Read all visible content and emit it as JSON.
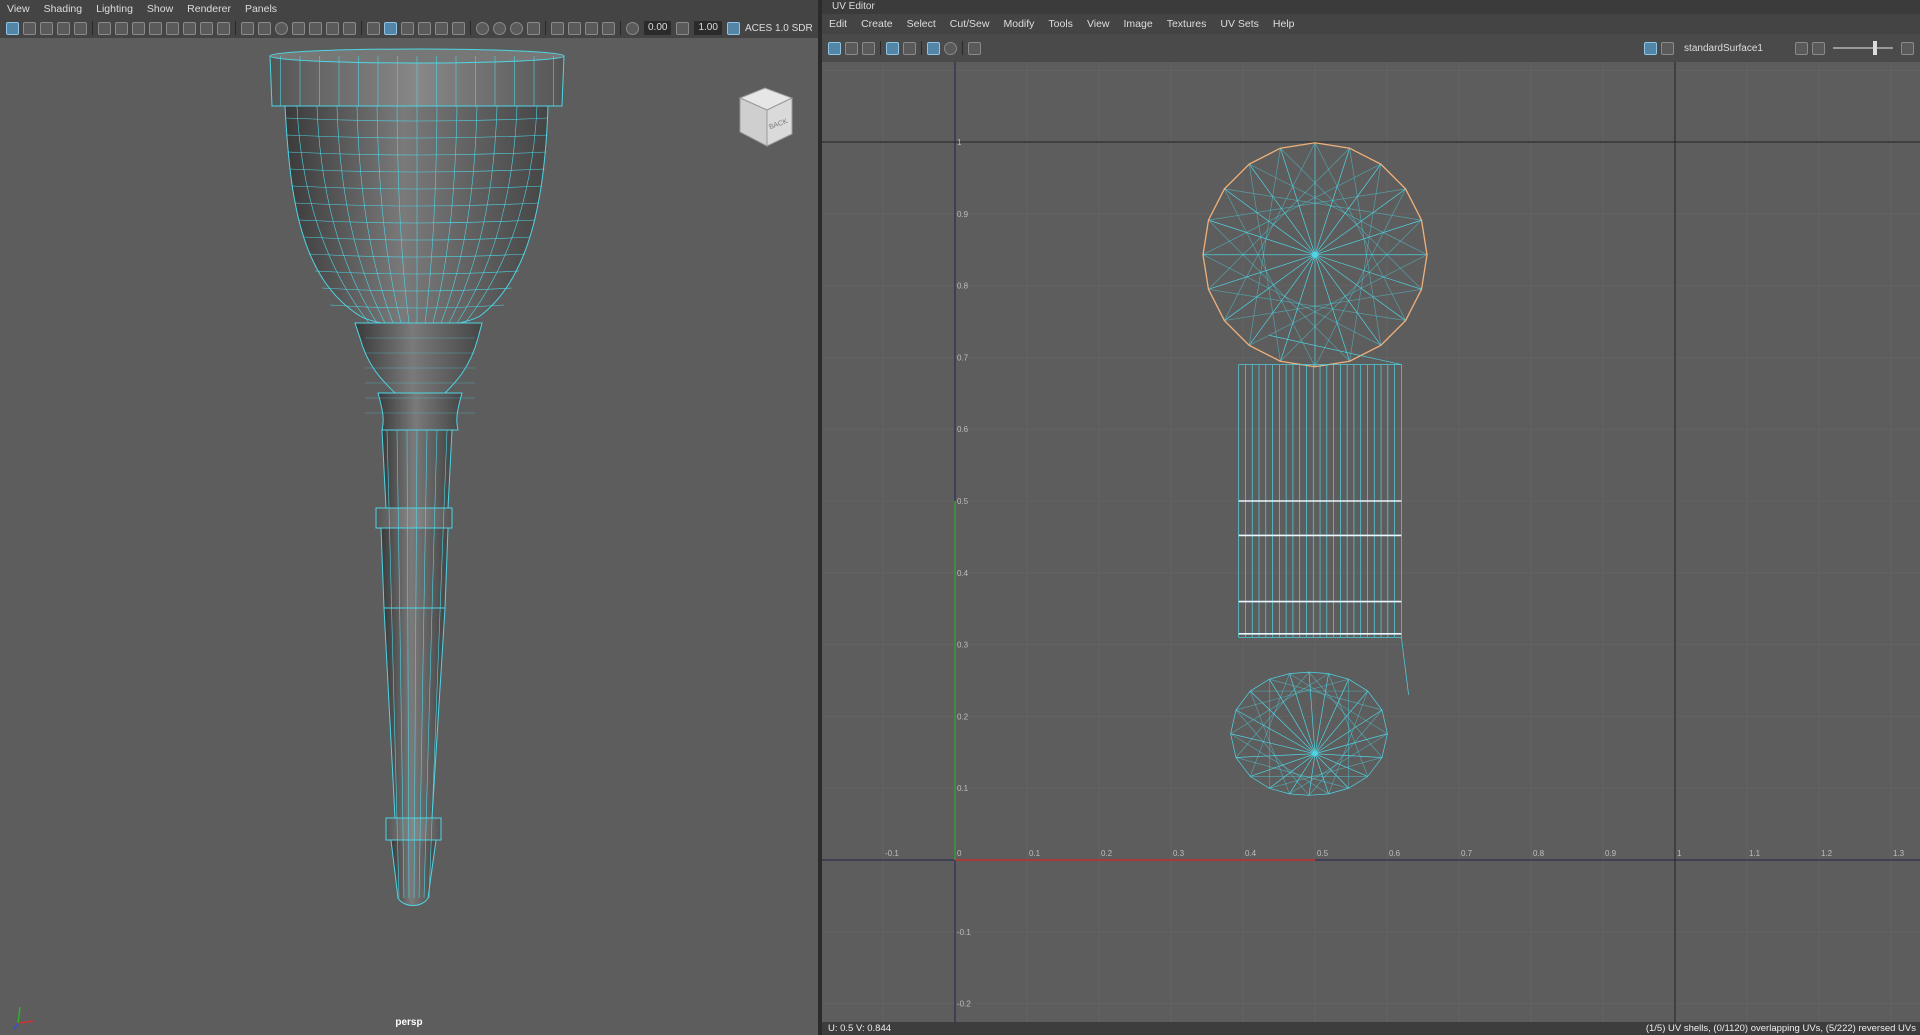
{
  "viewport": {
    "menus": [
      "View",
      "Shading",
      "Lighting",
      "Show",
      "Renderer",
      "Panels"
    ],
    "exposure_value": "0.00",
    "gamma_value": "1.00",
    "color_space": "ACES 1.0 SDR",
    "camera_label": "persp",
    "view_cube_label": "BACK"
  },
  "uv_editor": {
    "title": "UV Editor",
    "menus": [
      "Edit",
      "Create",
      "Select",
      "Cut/Sew",
      "Modify",
      "Tools",
      "View",
      "Image",
      "Textures",
      "UV Sets",
      "Help"
    ],
    "texture_name": "standardSurface1",
    "status_coord": "U: 0.5 V: 0.844",
    "status_info": "(1/5) UV shells, (0/1120) overlapping UVs, (5/222) reversed UVs",
    "u_ticks": [
      "-0.1",
      "0",
      "0.1",
      "0.2",
      "0.3",
      "0.4",
      "0.5",
      "0.6",
      "0.7",
      "0.8",
      "0.9",
      "1",
      "1.1",
      "1.2",
      "1.3"
    ],
    "v_ticks": [
      "-0.2",
      "-0.1",
      "0.1",
      "0.2",
      "0.3",
      "0.4",
      "0.5",
      "0.6",
      "0.7",
      "0.8",
      "0.9",
      "1"
    ]
  },
  "colors": {
    "wire": "#4fd4e4",
    "selected_shell": "#f0b07a",
    "u_axis": "#c03030",
    "v_axis": "#3a9a3a"
  }
}
